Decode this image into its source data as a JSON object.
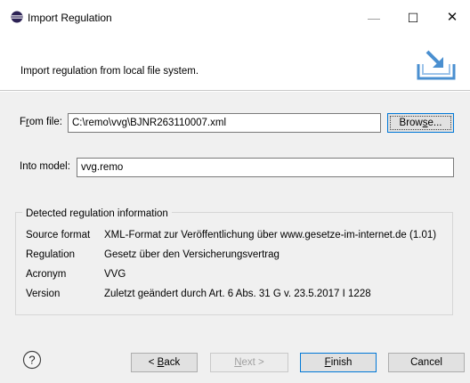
{
  "window": {
    "title": "Import Regulation",
    "minimize_symbol": "—",
    "maximize_symbol": "☐",
    "close_symbol": "✕"
  },
  "banner": {
    "message": "Import regulation from local file system.",
    "icon": "import-tray-icon"
  },
  "from_file": {
    "label_prefix": "F",
    "label_mnemonic": "r",
    "label_suffix": "om file:",
    "value": "C:\\remo\\vvg\\BJNR263110007.xml",
    "browse_prefix": "Brow",
    "browse_mnemonic": "s",
    "browse_suffix": "e..."
  },
  "into_model": {
    "label": "Into model:",
    "value": "vvg.remo"
  },
  "detected": {
    "group_title": "Detected regulation information",
    "rows": [
      {
        "key": "Source format",
        "value": "XML-Format zur Veröffentlichung über www.gesetze-im-internet.de (1.01)"
      },
      {
        "key": "Regulation",
        "value": "Gesetz über den Versicherungsvertrag"
      },
      {
        "key": "Acronym",
        "value": "VVG"
      },
      {
        "key": "Version",
        "value": "Zuletzt geändert durch Art. 6 Abs. 31 G v. 23.5.2017 I 1228"
      }
    ]
  },
  "footer": {
    "help_symbol": "?",
    "back_prefix": "< ",
    "back_mnemonic": "B",
    "back_suffix": "ack",
    "next_mnemonic": "N",
    "next_suffix": "ext >",
    "finish_mnemonic": "F",
    "finish_suffix": "inish",
    "cancel_label": "Cancel"
  },
  "colors": {
    "body_bg": "#f0f0f0",
    "default_button_border": "#0078d7",
    "icon_blue": "#4a8fd0"
  }
}
